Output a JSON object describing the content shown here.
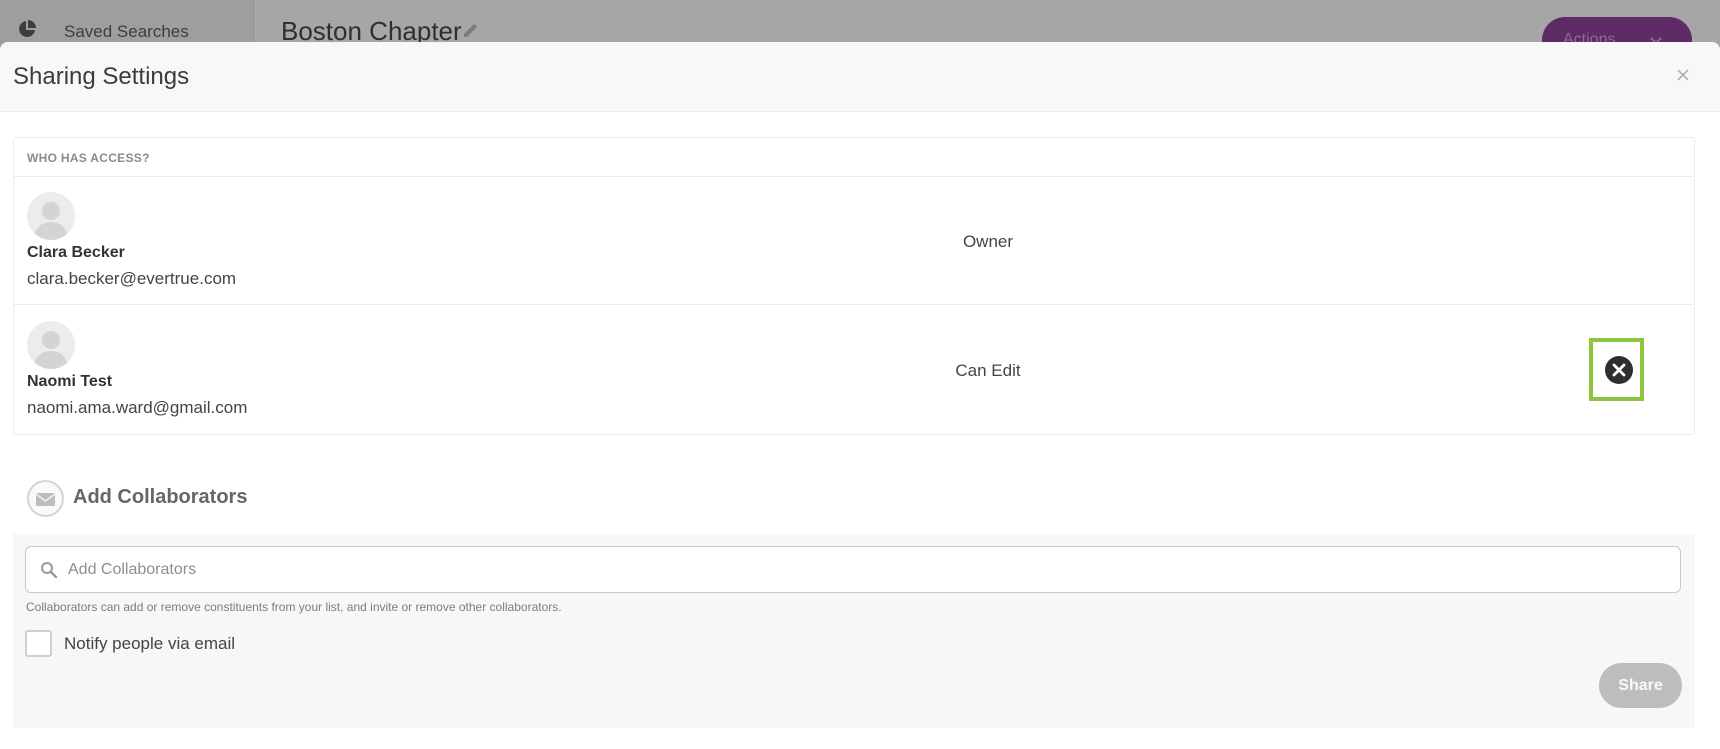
{
  "background": {
    "sidebar_label": "Saved Searches",
    "page_title": "Boston Chapter",
    "actions_label": "Actions"
  },
  "modal": {
    "title": "Sharing Settings",
    "access_heading": "WHO HAS ACCESS?",
    "people": [
      {
        "name": "Clara Becker",
        "email": "clara.becker@evertrue.com",
        "permission": "Owner"
      },
      {
        "name": "Naomi Test",
        "email": "naomi.ama.ward@gmail.com",
        "permission": "Can Edit"
      }
    ],
    "add_section_title": "Add Collaborators",
    "search": {
      "placeholder": "Add Collaborators",
      "value": ""
    },
    "help_text": "Collaborators can add or remove constituents from your list, and invite or remove other collaborators.",
    "notify_label": "Notify people via email",
    "notify_checked": false,
    "share_label": "Share"
  },
  "colors": {
    "highlight_border": "#8cc63f",
    "actions_button": "#5e2b66",
    "share_button_disabled": "#bdbdbd"
  },
  "icons": [
    "pie-chart-icon",
    "pencil-icon",
    "chevron-down-icon",
    "close-icon",
    "avatar-placeholder-icon",
    "remove-circle-icon",
    "envelope-icon",
    "search-icon"
  ]
}
